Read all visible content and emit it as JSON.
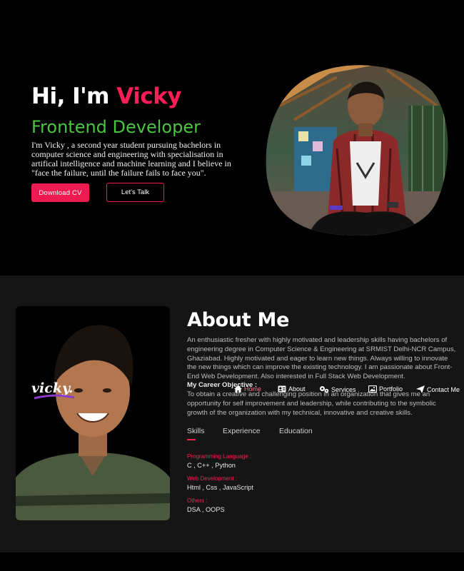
{
  "hero": {
    "greeting": "Hi, I'm ",
    "name": "Vicky",
    "role": "Frontend Developer",
    "description": "I'm Vicky , a second year student pursuing bachelors in computer science and engineering with specialisation in artifical intelligence and machine learning and I believe in \"face the failure, until the failure fails to face you\".",
    "download_cv_label": "Download CV",
    "lets_talk_label": "Let's Talk"
  },
  "about": {
    "title": "About Me",
    "text": "An enthusiastic fresher with highly motivated and leadership skills having bachelors of engineering degree in Computer Science & Engineering at SRMIST Delhi-NCR Campus, Ghaziabad. Highly motivated and eager to learn new things. Always willing to innovate the new things which can improve the existing technology. I am passionate about Front-End Web Development. Also interested in Full Stack Web Development.",
    "objective_heading": "My Career Objective :",
    "objective_text": "To obtain a creative and challenging position in an organization that gives me an opportunity for self improvement and leadership, while contributing to the symbolic growth of the organization with my technical, innovative and creative skills.",
    "logo_text": "vicky.",
    "tabs": [
      {
        "label": "Skills"
      },
      {
        "label": "Experience"
      },
      {
        "label": "Education"
      }
    ],
    "skills": [
      {
        "label": "Programming Language :",
        "value": "C , C++ , Python"
      },
      {
        "label": "Web Development :",
        "value": "Html , Css , JavaScript"
      },
      {
        "label": "Others :",
        "value": "DSA , OOPS"
      }
    ]
  },
  "nav": {
    "items": [
      {
        "label": "Home",
        "icon": "home-icon"
      },
      {
        "label": "About",
        "icon": "user-card-icon"
      },
      {
        "label": "Services",
        "icon": "gears-icon"
      },
      {
        "label": "Portfolio",
        "icon": "image-icon"
      },
      {
        "label": "Contact Me",
        "icon": "send-icon"
      }
    ]
  },
  "colors": {
    "accent": "#ff1d58",
    "role": "#49c540",
    "background": "#000000",
    "section": "#151515"
  }
}
